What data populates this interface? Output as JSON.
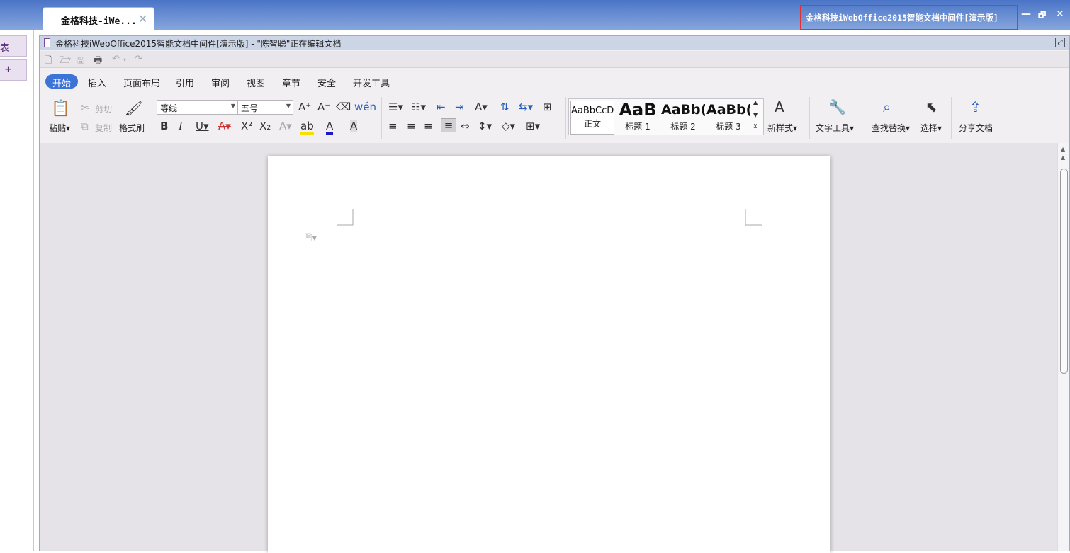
{
  "browser": {
    "tab_title": "金格科技-iWe...",
    "tab_close": "✕",
    "window_title": "金格科技iWebOffice2015智能文档中间件[演示版]",
    "minimize": "—",
    "restore": "🗗",
    "close": "✕"
  },
  "sidebar": {
    "btn1": "表",
    "btn2": "+"
  },
  "app": {
    "title": "金格科技iWebOffice2015智能文档中间件[演示版] - \"陈智聪\"正在编辑文档"
  },
  "ribbon_tabs": [
    "开始",
    "插入",
    "页面布局",
    "引用",
    "审阅",
    "视图",
    "章节",
    "安全",
    "开发工具"
  ],
  "clipboard": {
    "paste": "粘贴",
    "cut": "剪切",
    "copy": "复制",
    "format_painter": "格式刷"
  },
  "font": {
    "name": "等线",
    "size": "五号"
  },
  "styles": [
    {
      "sample": "AaBbCcD",
      "name": "正文"
    },
    {
      "sample": "AaB",
      "name": "标题 1"
    },
    {
      "sample": "AaBb(",
      "name": "标题 2"
    },
    {
      "sample": "AaBb(",
      "name": "标题 3"
    }
  ],
  "tools": {
    "new_style": "新样式",
    "text_tools": "文字工具",
    "find_replace": "查找替换",
    "select": "选择",
    "share": "分享文档"
  }
}
